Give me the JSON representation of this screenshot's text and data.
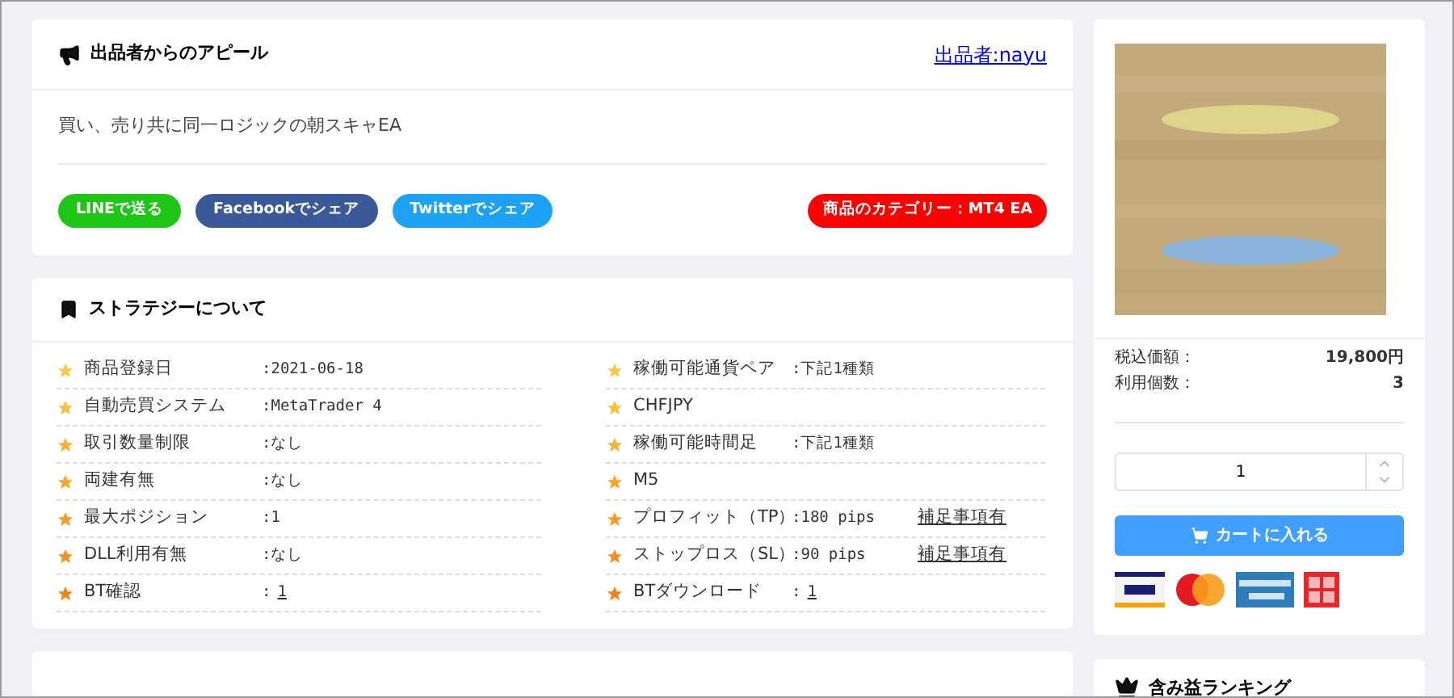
{
  "appeal": {
    "title": "出品者からのアピール",
    "seller_link": "出品者:nayu",
    "text": "買い、売り共に同一ロジックの朝スキャEA",
    "share_buttons": [
      {
        "label": "LINEで送る",
        "color": "#1ec716"
      },
      {
        "label": "Facebookでシェア",
        "color": "#3b5998"
      },
      {
        "label": "Twitterでシェア",
        "color": "#1da1f2"
      }
    ],
    "category": "商品のカテゴリー：MT4 EA"
  },
  "strategy": {
    "title": "ストラテジーについて",
    "columns": [
      [
        {
          "label": "商品登録日",
          "value": ":2021-06-18",
          "color": "#f9c847"
        },
        {
          "label": "自動売買システム",
          "value": ":MetaTrader 4",
          "color": "#f8bf3c"
        },
        {
          "label": "取引数量制限",
          "value": ":なし",
          "color": "#f7b433"
        },
        {
          "label": "両建有無",
          "value": ":なし",
          "color": "#f6a82b"
        },
        {
          "label": "最大ポジション",
          "value": ":1",
          "color": "#f49c24"
        },
        {
          "label": "DLL利用有無",
          "value": ":なし",
          "color": "#f2901d"
        },
        {
          "label": "BT確認",
          "value": ":",
          "link": "1",
          "color": "#f08418"
        }
      ],
      [
        {
          "label": "稼働可能通貨ペア",
          "value": ":下記1種類",
          "color": "#f9c847"
        },
        {
          "label": "CHFJPY",
          "color": "#f8bf3c"
        },
        {
          "label": "稼働可能時間足",
          "value": ":下記1種類",
          "color": "#f7b433"
        },
        {
          "label": "M5",
          "color": "#f6a82b"
        },
        {
          "label": "プロフィット（TP）",
          "value": ":180 pips",
          "note": "補足事項有",
          "color": "#f49c24"
        },
        {
          "label": "ストップロス（SL）",
          "value": ":90 pips",
          "note": "補足事項有",
          "color": "#f2901d"
        },
        {
          "label": "BTダウンロード",
          "value": ":",
          "link": "1",
          "color": "#f08418"
        }
      ]
    ]
  },
  "product": {
    "price_label": "税込価額：",
    "price": "19,800円",
    "count_label": "利用個数：",
    "count": "3",
    "quantity": "1",
    "cart_button": "カートに入れる"
  },
  "ranking": {
    "title": "含み益ランキング"
  }
}
